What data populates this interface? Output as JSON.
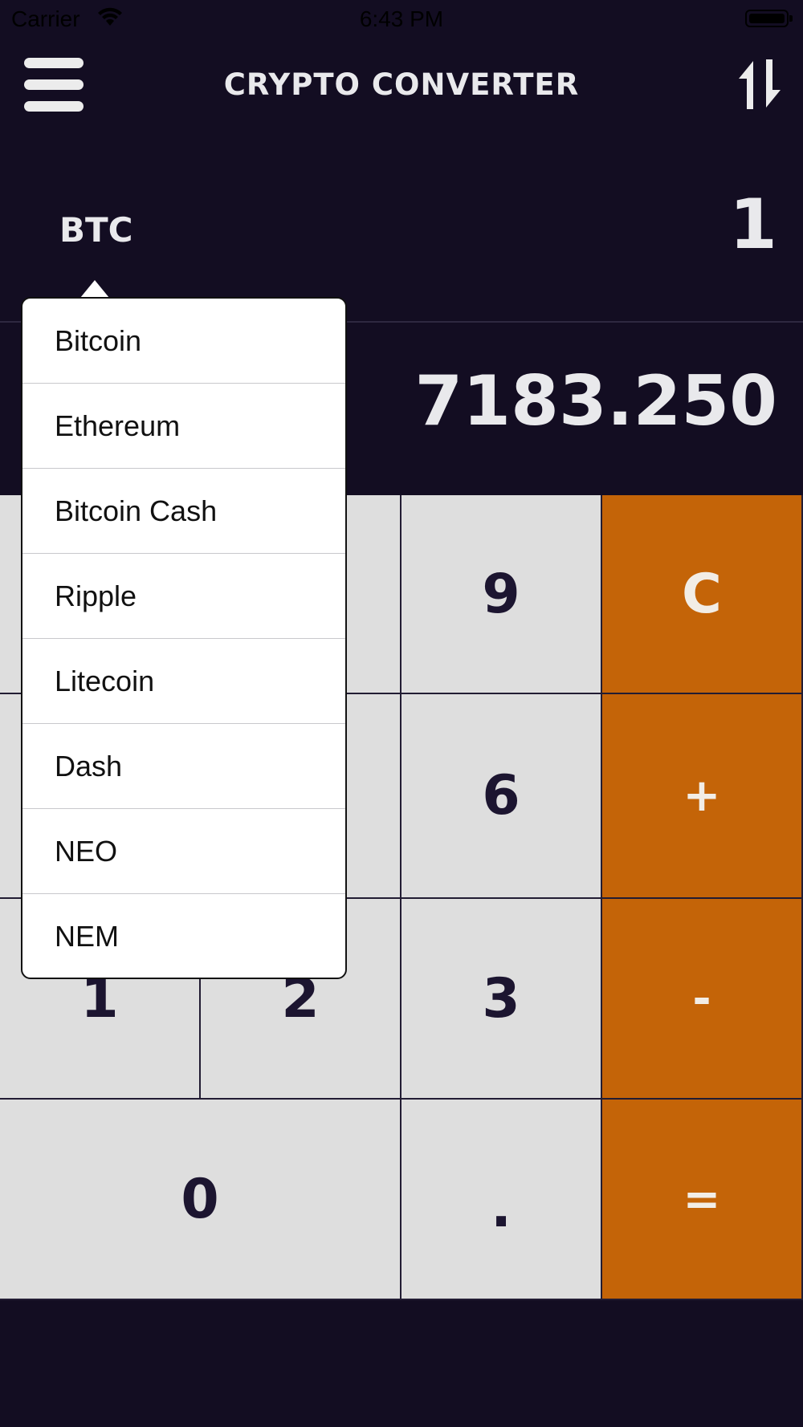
{
  "status_bar": {
    "carrier": "Carrier",
    "time": "6:43 PM"
  },
  "navbar": {
    "title": "CRYPTO CONVERTER",
    "menu_icon": "hamburger-menu-icon",
    "swap_icon": "swap-arrows-icon"
  },
  "converter": {
    "from_currency": "BTC",
    "from_value": "1",
    "to_value": "7183.250"
  },
  "keypad": {
    "k9": "9",
    "k6": "6",
    "k1": "1",
    "k2": "2",
    "k3": "3",
    "k0": "0",
    "dot": ".",
    "clear": "C",
    "plus": "+",
    "minus": "-",
    "equals": "="
  },
  "currency_menu": {
    "items": [
      "Bitcoin",
      "Ethereum",
      "Bitcoin Cash",
      "Ripple",
      "Litecoin",
      "Dash",
      "NEO",
      "NEM"
    ]
  },
  "colors": {
    "background": "#130d22",
    "key": "#dedede",
    "operator": "#c46408",
    "text_light": "#e9e9ec"
  }
}
